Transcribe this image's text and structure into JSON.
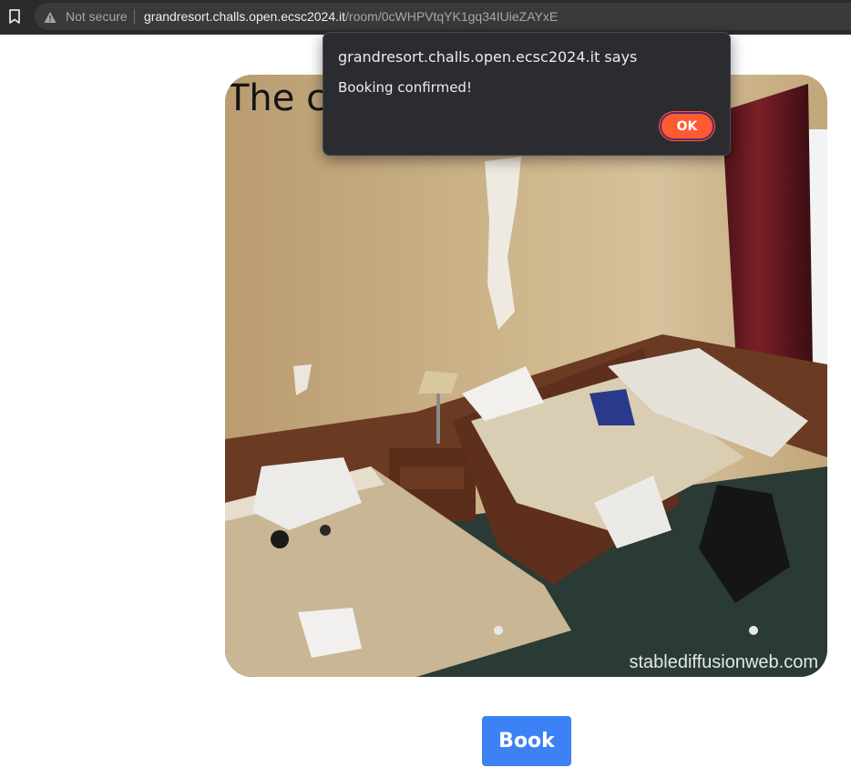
{
  "browser": {
    "security_label": "Not secure",
    "url_host": "grandresort.challs.open.ecsc2024.it",
    "url_path": "/room/0cWHPVtqYK1gq34IUieZAYxE"
  },
  "page": {
    "room_title": "The c",
    "image_watermark": "stablediffusionweb.com",
    "book_button_label": "Book"
  },
  "dialog": {
    "title": "grandresort.challs.open.ecsc2024.it says",
    "message": "Booking confirmed!",
    "ok_label": "OK"
  },
  "colors": {
    "accent_blue": "#3d82f5",
    "dialog_ok": "#ff5a30",
    "dialog_bg": "#2b2c30"
  }
}
